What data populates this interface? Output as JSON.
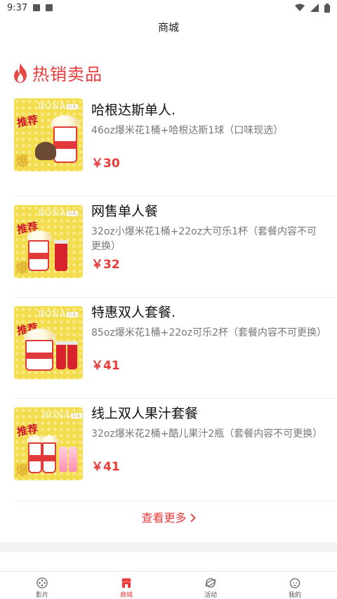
{
  "status_bar": {
    "time": "9:37"
  },
  "nav": {
    "title": "商城"
  },
  "section": {
    "title": "热销卖品"
  },
  "products": [
    {
      "name": "哈根达斯单人.",
      "desc": "46oz爆米花1桶+哈根达斯1球（口味现选）",
      "price": "￥30",
      "badge": "推荐",
      "brand": "BONA",
      "brand_tag": "UA"
    },
    {
      "name": "网售单人餐",
      "desc": "32oz小爆米花1桶+22oz大可乐1杯（套餐内容不可更换）",
      "price": "￥32",
      "badge": "推荐",
      "brand": "BONA",
      "brand_tag": "UA"
    },
    {
      "name": "特惠双人套餐.",
      "desc": "85oz爆米花1桶+22oz可乐2杯（套餐内容不可更换）",
      "price": "￥41",
      "badge": "推荐",
      "brand": "BONA",
      "brand_tag": "UA"
    },
    {
      "name": "线上双人果汁套餐",
      "desc": "32oz爆米花2桶+酷儿果汁2瓶（套餐内容不可更换）",
      "price": "￥41",
      "badge": "推荐",
      "brand": "BONA",
      "brand_tag": "UA"
    }
  ],
  "view_more": {
    "label": "查看更多"
  },
  "tabs": [
    {
      "label": "影片",
      "icon": "film-reel-icon"
    },
    {
      "label": "商城",
      "icon": "store-icon",
      "active": true
    },
    {
      "label": "活动",
      "icon": "planet-icon"
    },
    {
      "label": "我的",
      "icon": "face-icon"
    }
  ],
  "colors": {
    "accent": "#e83a3a",
    "thumb_bg": "#f4dc4f"
  }
}
